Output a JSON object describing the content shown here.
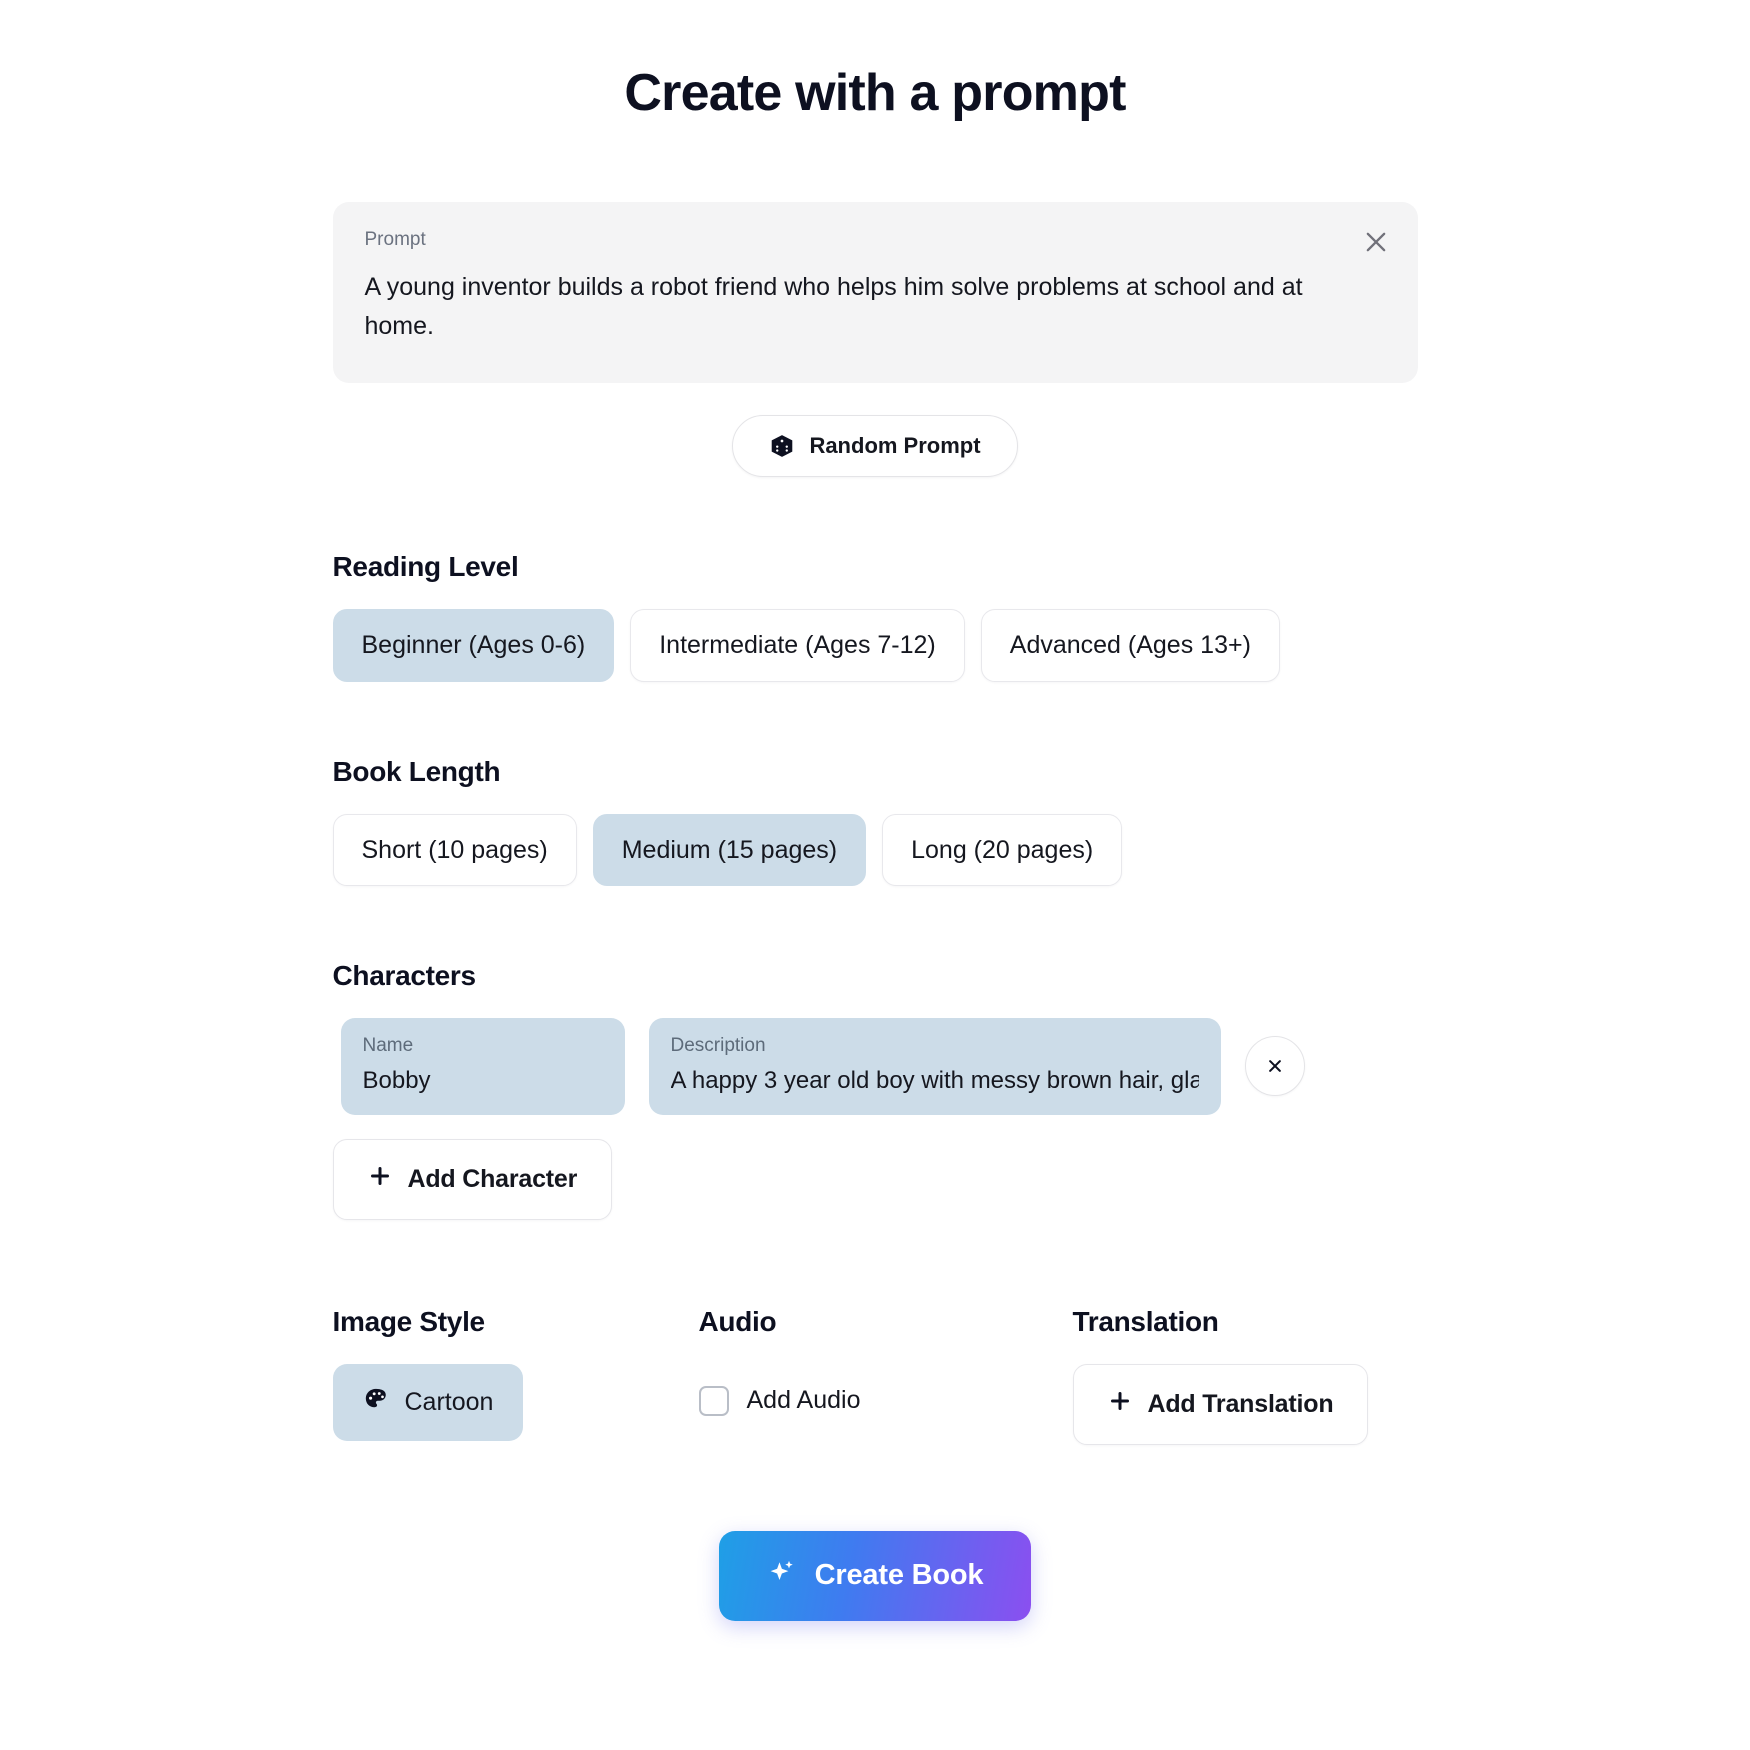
{
  "header": {
    "title": "Create with a prompt"
  },
  "prompt": {
    "label": "Prompt",
    "text": "A young inventor builds a robot friend who helps him solve problems at school and at home.",
    "close_icon": "close-icon",
    "random_button": {
      "label": "Random Prompt",
      "icon": "dice-icon"
    }
  },
  "reading_level": {
    "title": "Reading Level",
    "options": [
      {
        "label": "Beginner (Ages 0-6)",
        "selected": true
      },
      {
        "label": "Intermediate (Ages 7-12)",
        "selected": false
      },
      {
        "label": "Advanced (Ages 13+)",
        "selected": false
      }
    ]
  },
  "book_length": {
    "title": "Book Length",
    "options": [
      {
        "label": "Short (10 pages)",
        "selected": false
      },
      {
        "label": "Medium (15 pages)",
        "selected": true
      },
      {
        "label": "Long (20 pages)",
        "selected": false
      }
    ]
  },
  "characters": {
    "title": "Characters",
    "rows": [
      {
        "name_label": "Name",
        "name_value": "Bobby",
        "description_label": "Description",
        "description_value": "A happy 3 year old boy with messy brown hair, gla",
        "remove_icon": "close-icon"
      }
    ],
    "add_button": {
      "label": "Add Character",
      "icon": "plus-icon"
    }
  },
  "image_style": {
    "title": "Image Style",
    "selected": {
      "label": "Cartoon",
      "icon": "palette-icon"
    }
  },
  "audio": {
    "title": "Audio",
    "checkbox_label": "Add Audio",
    "checked": false
  },
  "translation": {
    "title": "Translation",
    "add_button": {
      "label": "Add Translation",
      "icon": "plus-icon"
    }
  },
  "submit": {
    "label": "Create Book",
    "icon": "sparkle-icon",
    "gradient_from": "#1f9fe6",
    "gradient_to": "#8b4ff0"
  },
  "colors": {
    "selected_pill": "#ccdce8",
    "card_bg": "#f4f4f5",
    "text": "#15171f",
    "muted_text": "#6b7280"
  }
}
